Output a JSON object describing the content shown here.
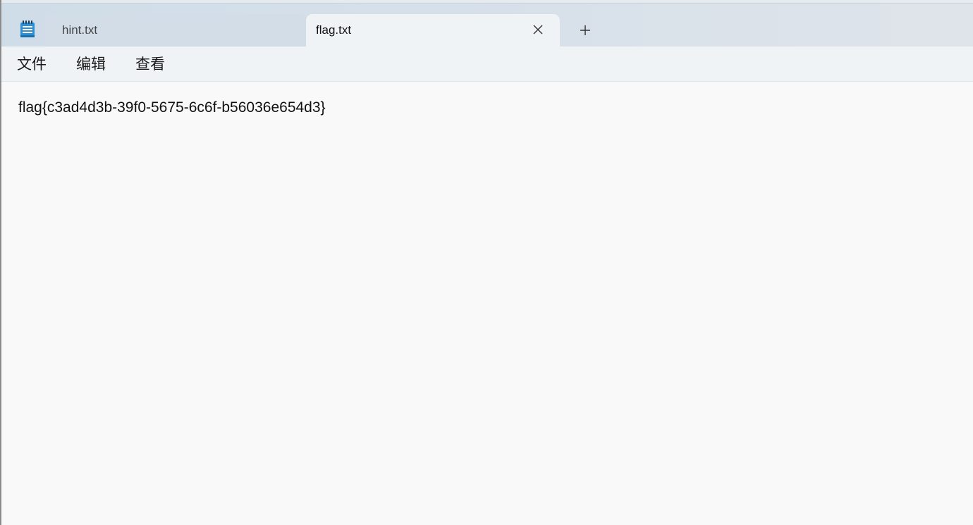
{
  "tabs": [
    {
      "label": "hint.txt",
      "active": false
    },
    {
      "label": "flag.txt",
      "active": true
    }
  ],
  "menu": {
    "file": "文件",
    "edit": "编辑",
    "view": "查看"
  },
  "editor": {
    "content": "flag{c3ad4d3b-39f0-5675-6c6f-b56036e654d3}"
  },
  "icons": {
    "app": "notepad-icon",
    "close": "close-icon",
    "new_tab": "plus-icon"
  },
  "colors": {
    "tab_strip": "#d6e0ea",
    "active_tab": "#f0f3f6",
    "app_icon": "#2b8fd6"
  }
}
